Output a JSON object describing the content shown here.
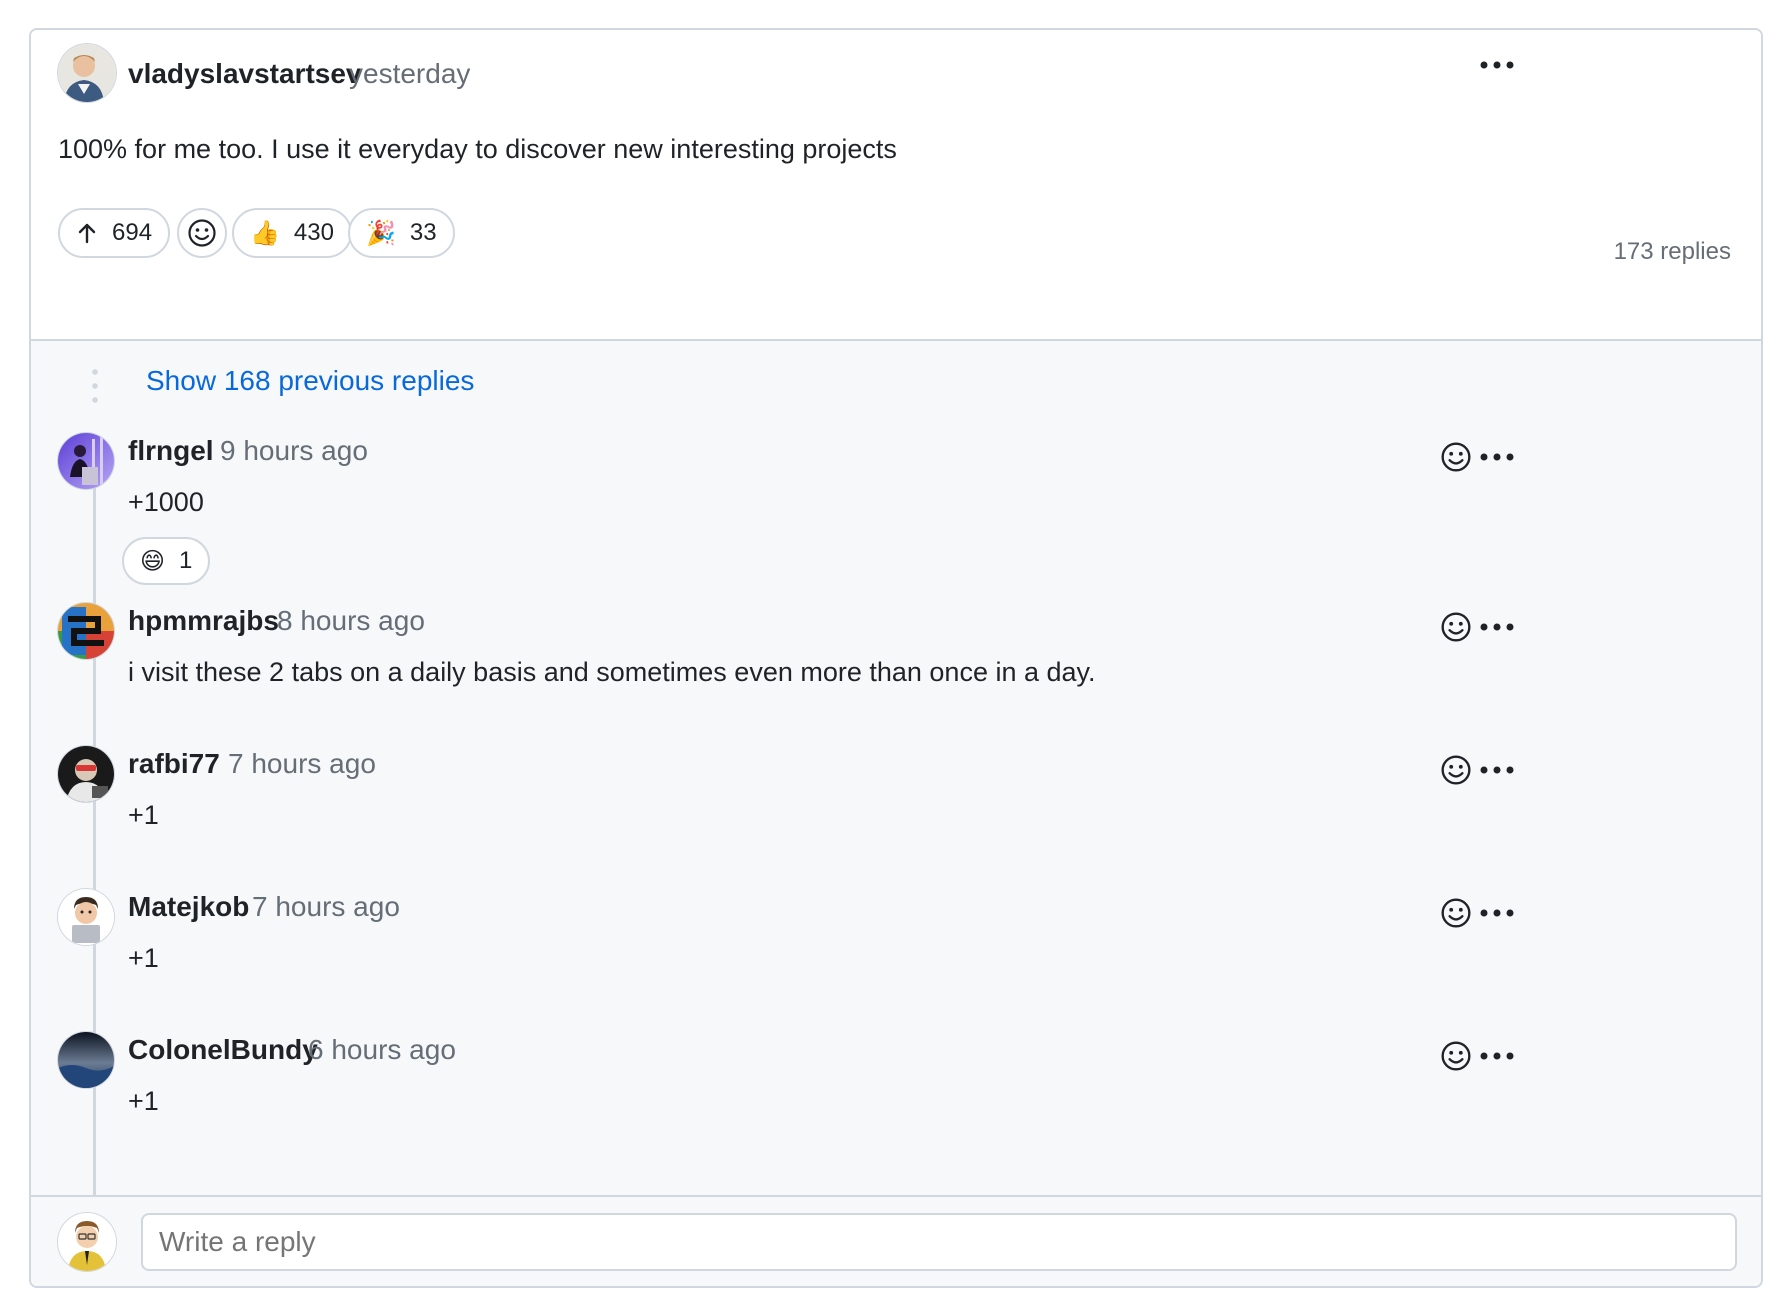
{
  "post": {
    "author": "vladyslavstartsev",
    "time": "yesterday",
    "body": "100% for me too. I use it everyday to discover new interesting projects",
    "upvotes": "694",
    "reactions": [
      {
        "emoji": "👍",
        "count": "430"
      },
      {
        "emoji": "🎉",
        "count": "33"
      }
    ],
    "replies_count": "173 replies"
  },
  "thread": {
    "show_previous": "Show 168 previous replies",
    "replies": [
      {
        "author": "flrngel",
        "time": "9 hours ago",
        "body": "+1000",
        "reaction": {
          "emoji": "😄",
          "count": "1"
        }
      },
      {
        "author": "hpmmrajbs",
        "time": "8 hours ago",
        "body": "i visit these 2 tabs on a daily basis and sometimes even more than once in a day."
      },
      {
        "author": "rafbi77",
        "time": "7 hours ago",
        "body": "+1"
      },
      {
        "author": "Matejkob",
        "time": "7 hours ago",
        "body": "+1"
      },
      {
        "author": "ColonelBundy",
        "time": "6 hours ago",
        "body": "+1"
      }
    ]
  },
  "composer": {
    "placeholder": "Write a reply"
  },
  "colors": {
    "link": "#0969da",
    "muted": "#656d76",
    "border": "#d0d7de",
    "thread_bg": "#f6f8fa"
  }
}
